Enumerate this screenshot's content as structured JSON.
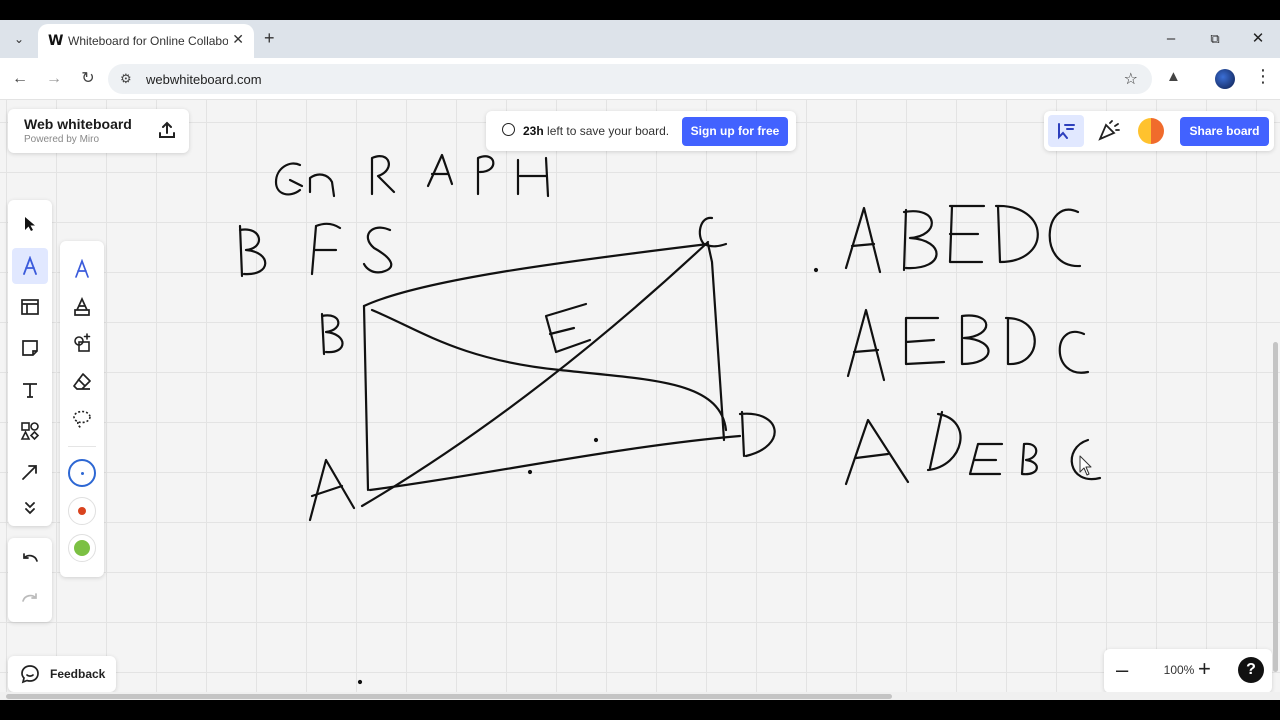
{
  "browser": {
    "tab_title": "Whiteboard for Online Collabor",
    "tab_favicon": "W",
    "url": "webwhiteboard.com",
    "icons": [
      "tab-list-icon",
      "close-icon",
      "plus-icon",
      "minimize-icon",
      "restore-icon",
      "close-window-icon",
      "back-icon",
      "forward-icon",
      "reload-icon",
      "site-info-icon",
      "star-icon",
      "extensions-icon",
      "profile-avatar",
      "menu-dots-icon"
    ]
  },
  "header": {
    "brand_title": "Web whiteboard",
    "brand_sub": "Powered by Miro",
    "save_time": "23h",
    "save_text": "left to save your board.",
    "signup_label": "Sign up for free",
    "share_label": "Share board"
  },
  "toolbar": {
    "tools": [
      "select-icon",
      "pen-icon",
      "frame-icon",
      "sticky-note-icon",
      "text-icon",
      "shapes-icon",
      "arrow-icon",
      "more-tools-icon"
    ],
    "active": "pen-icon"
  },
  "pen_panel": {
    "tools": [
      "pen-tool",
      "highlighter-tool",
      "smart-draw-tool",
      "eraser-tool",
      "lasso-tool"
    ],
    "colors": [
      "#2d67d3",
      "#d9431e",
      "#7bc043"
    ]
  },
  "footer": {
    "feedback_label": "Feedback",
    "zoom_level": "100%",
    "help_label": "?"
  },
  "colors": {
    "accent": "#4262ff",
    "canvas": "#f4f4f4",
    "ink": "#111111"
  }
}
